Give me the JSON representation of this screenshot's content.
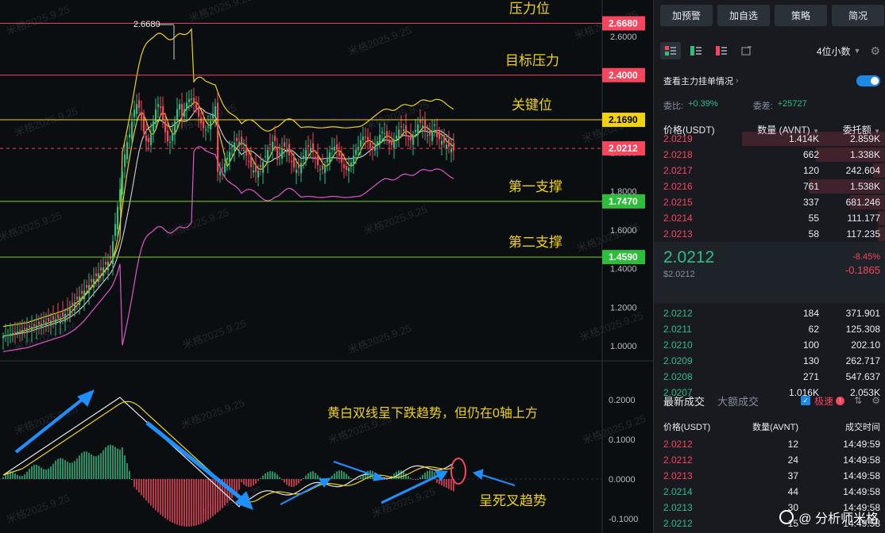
{
  "chart": {
    "y_ticks": [
      "2.6000",
      "2.0000",
      "1.8000",
      "1.6000",
      "1.4000",
      "1.2000",
      "1.0000"
    ],
    "macd_ticks": [
      "0.2000",
      "0.1000",
      "0.0000",
      "-0.1000"
    ],
    "levels": [
      {
        "label": "2.6680",
        "name": "压力位",
        "color": "#f6465d",
        "line": "#f6465d"
      },
      {
        "label": "2.4000",
        "name": "目标压力",
        "color": "#f6465d",
        "line": "#f6465d"
      },
      {
        "label": "2.1690",
        "name": "关键位",
        "color": "#f0d30e",
        "line": "#f0d30e"
      },
      {
        "label": "2.0212",
        "name": "",
        "color": "#f6465d",
        "line": "#f6465d"
      },
      {
        "label": "1.7470",
        "name": "第一支撑",
        "color": "#2ebd3a",
        "line": "#7ed321"
      },
      {
        "label": "1.4590",
        "name": "第二支撑",
        "color": "#2ebd3a",
        "line": "#7ed321"
      }
    ],
    "high_marker": "2.6680",
    "macd_note": "黄白双线呈下跌趋势，但仍在0轴上方",
    "death_cross_note": "呈死叉趋势",
    "watermark": "米格2025.9.25"
  },
  "toolbar": {
    "buttons": [
      "加预警",
      "加自选",
      "策略",
      "简况"
    ],
    "decimal": "4位小数"
  },
  "orderbook_header": {
    "view_label": "查看主力挂单情况",
    "ratio_label": "委比:",
    "ratio_value": "+0.39%",
    "diff_label": "委差:",
    "diff_value": "+25727",
    "price_col": "价格(USDT)",
    "qty_col": "数量 (AVNT)",
    "total_col": "委托额"
  },
  "asks": [
    {
      "price": "2.0219",
      "qty": "1.414K",
      "total": "2.859K",
      "depth": 0.62
    },
    {
      "price": "2.0218",
      "qty": "662",
      "total": "1.338K",
      "depth": 0.3
    },
    {
      "price": "2.0217",
      "qty": "120",
      "total": "242.604",
      "depth": 0.05
    },
    {
      "price": "2.0216",
      "qty": "761",
      "total": "1.538K",
      "depth": 0.33
    },
    {
      "price": "2.0215",
      "qty": "337",
      "total": "681.246",
      "depth": 0.15
    },
    {
      "price": "2.0214",
      "qty": "55",
      "total": "111.177",
      "depth": 0.03
    },
    {
      "price": "2.0213",
      "qty": "58",
      "total": "117.235",
      "depth": 0.03
    }
  ],
  "mid": {
    "price": "2.0212",
    "usd": "$2.0212",
    "pct": "-8.45%",
    "change": "-0.1865"
  },
  "bids": [
    {
      "price": "2.0212",
      "qty": "184",
      "total": "371.901"
    },
    {
      "price": "2.0211",
      "qty": "62",
      "total": "125.308"
    },
    {
      "price": "2.0210",
      "qty": "100",
      "total": "202.10"
    },
    {
      "price": "2.0209",
      "qty": "130",
      "total": "262.717"
    },
    {
      "price": "2.0208",
      "qty": "271",
      "total": "547.637"
    },
    {
      "price": "2.0207",
      "qty": "1.016K",
      "total": "2.053K"
    }
  ],
  "trades_tabs": {
    "latest": "最新成交",
    "large": "大额成交",
    "fast": "极速"
  },
  "trades_header": {
    "price": "价格(USDT)",
    "qty": "数量(AVNT)",
    "time": "成交时间"
  },
  "trades": [
    {
      "price": "2.0212",
      "qty": "12",
      "time": "14:49:59",
      "side": "sell"
    },
    {
      "price": "2.0212",
      "qty": "24",
      "time": "14:49:58",
      "side": "sell"
    },
    {
      "price": "2.0213",
      "qty": "37",
      "time": "14:49:58",
      "side": "sell"
    },
    {
      "price": "2.0214",
      "qty": "44",
      "time": "14:49:58",
      "side": "buy"
    },
    {
      "price": "2.0213",
      "qty": "30",
      "time": "14:49:58",
      "side": "buy"
    },
    {
      "price": "2.0212",
      "qty": "15",
      "time": "14:49:58",
      "side": "buy"
    }
  ],
  "brand": "@ 分析师米格"
}
